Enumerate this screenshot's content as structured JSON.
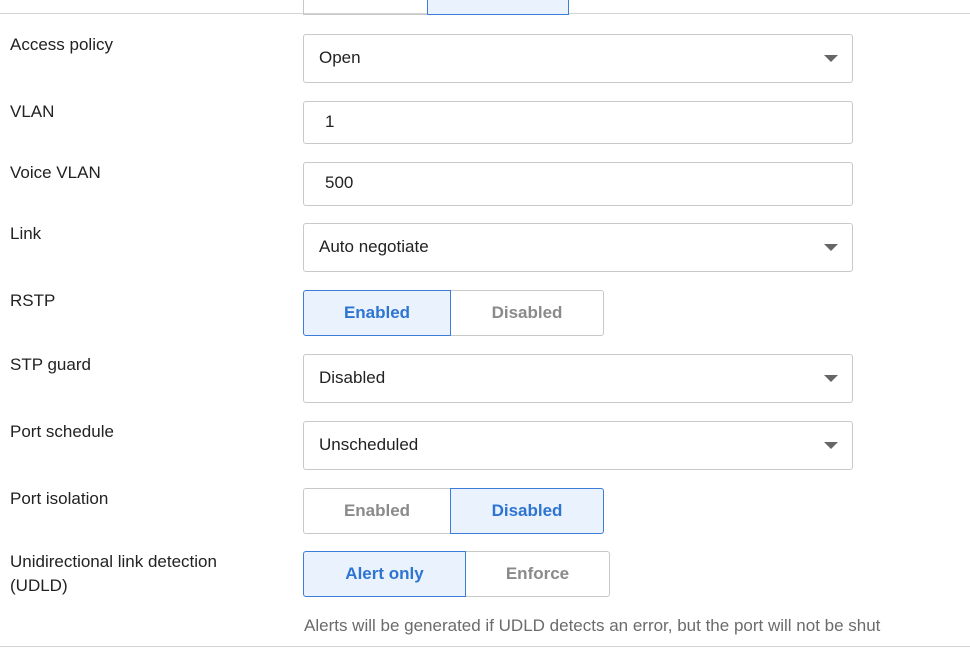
{
  "fields": {
    "access_policy": {
      "label": "Access policy",
      "value": "Open"
    },
    "vlan": {
      "label": "VLAN",
      "value": "1"
    },
    "voice_vlan": {
      "label": "Voice VLAN",
      "value": "500"
    },
    "link": {
      "label": "Link",
      "value": "Auto negotiate"
    },
    "rstp": {
      "label": "RSTP",
      "options": [
        "Enabled",
        "Disabled"
      ],
      "selected": "Enabled"
    },
    "stp_guard": {
      "label": "STP guard",
      "value": "Disabled"
    },
    "port_schedule": {
      "label": "Port schedule",
      "value": "Unscheduled"
    },
    "port_isolation": {
      "label": "Port isolation",
      "options": [
        "Enabled",
        "Disabled"
      ],
      "selected": "Disabled"
    },
    "udld": {
      "label_line1": "Unidirectional link detection",
      "label_line2": "(UDLD)",
      "options": [
        "Alert only",
        "Enforce"
      ],
      "selected": "Alert only",
      "help": "Alerts will be generated if UDLD detects an error, but the port will not be shut"
    }
  },
  "colors": {
    "accent": "#2e74d1",
    "accent_bg": "#eaf2fd",
    "border": "#c8c8c8",
    "muted": "#8a8a8a"
  },
  "icons": {
    "dropdown": "chevron-down-icon"
  }
}
